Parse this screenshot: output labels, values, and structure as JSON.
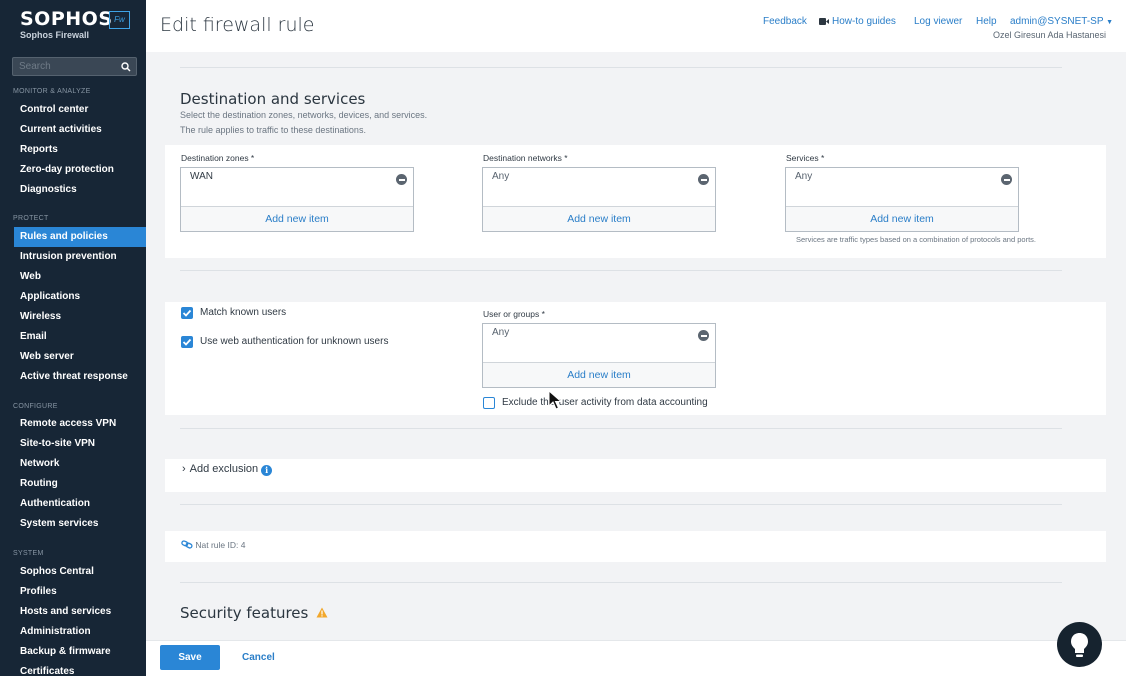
{
  "brand": {
    "name": "SOPHOS",
    "product": "Sophos Firewall",
    "badge": "Fw"
  },
  "search": {
    "placeholder": "Search"
  },
  "sidebar": {
    "monitor_head": "MONITOR & ANALYZE",
    "monitor": [
      "Control center",
      "Current activities",
      "Reports",
      "Zero-day protection",
      "Diagnostics"
    ],
    "protect_head": "PROTECT",
    "protect": [
      "Rules and policies",
      "Intrusion prevention",
      "Web",
      "Applications",
      "Wireless",
      "Email",
      "Web server",
      "Active threat response"
    ],
    "configure_head": "CONFIGURE",
    "configure": [
      "Remote access VPN",
      "Site-to-site VPN",
      "Network",
      "Routing",
      "Authentication",
      "System services"
    ],
    "system_head": "SYSTEM",
    "system": [
      "Sophos Central",
      "Profiles",
      "Hosts and services",
      "Administration",
      "Backup & firmware",
      "Certificates"
    ]
  },
  "header": {
    "title": "Edit firewall rule",
    "links": {
      "feedback": "Feedback",
      "howto": "How-to guides",
      "log_viewer": "Log viewer",
      "help": "Help"
    },
    "user": "admin@SYSNET-SP",
    "org": "Ozel Giresun Ada Hastanesi"
  },
  "destination": {
    "title": "Destination and services",
    "desc1": "Select the destination zones, networks, devices, and services.",
    "desc2": "The rule applies to traffic to these destinations.",
    "zones": {
      "label": "Destination zones *",
      "value": "WAN",
      "add": "Add new item"
    },
    "networks": {
      "label": "Destination networks *",
      "value": "Any",
      "add": "Add new item"
    },
    "services": {
      "label": "Services *",
      "value": "Any",
      "add": "Add new item",
      "hint": "Services are traffic types based on a combination of protocols and ports."
    }
  },
  "identity": {
    "match_known_users": "Match known users",
    "web_auth": "Use web authentication for unknown users",
    "groups": {
      "label": "User or groups *",
      "value": "Any",
      "add": "Add new item"
    },
    "exclude": "Exclude this user activity from data accounting"
  },
  "exclusion": {
    "label": "Add exclusion"
  },
  "nat": {
    "label": "Nat rule ID: 4"
  },
  "security": {
    "title": "Security features"
  },
  "footer": {
    "save": "Save",
    "cancel": "Cancel"
  }
}
